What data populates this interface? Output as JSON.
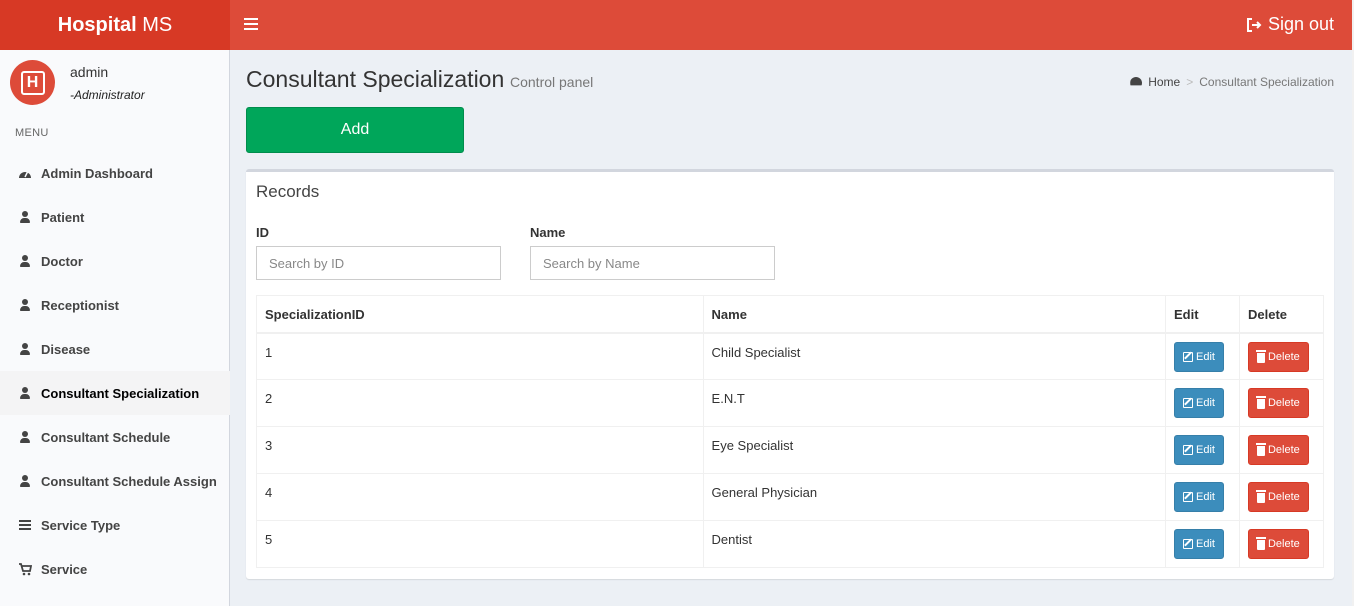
{
  "header": {
    "logo_bold": "Hospital",
    "logo_light": "MS",
    "signout_label": "Sign out"
  },
  "sidebar": {
    "user_name": "admin",
    "user_role": "-Administrator",
    "avatar_letter": "H",
    "menu_header": "MENU",
    "items": [
      {
        "label": "Admin Dashboard",
        "icon": "dashboard-icon"
      },
      {
        "label": "Patient",
        "icon": "user-icon"
      },
      {
        "label": "Doctor",
        "icon": "user-icon"
      },
      {
        "label": "Receptionist",
        "icon": "user-icon"
      },
      {
        "label": "Disease",
        "icon": "user-icon"
      },
      {
        "label": "Consultant Specialization",
        "icon": "user-icon",
        "active": true
      },
      {
        "label": "Consultant Schedule",
        "icon": "user-icon"
      },
      {
        "label": "Consultant Schedule Assign",
        "icon": "user-icon"
      },
      {
        "label": "Service Type",
        "icon": "list-icon"
      },
      {
        "label": "Service",
        "icon": "cart-icon"
      }
    ]
  },
  "content": {
    "title": "Consultant Specialization",
    "subtitle": "Control panel",
    "breadcrumb_home": "Home",
    "breadcrumb_sep": ">",
    "breadcrumb_current": "Consultant Specialization",
    "add_label": "Add"
  },
  "records": {
    "title": "Records",
    "id_label": "ID",
    "id_placeholder": "Search by ID",
    "name_label": "Name",
    "name_placeholder": "Search by Name",
    "columns": [
      "SpecializationID",
      "Name",
      "Edit",
      "Delete"
    ],
    "edit_label": "Edit",
    "delete_label": "Delete",
    "rows": [
      {
        "id": "1",
        "name": "Child Specialist"
      },
      {
        "id": "2",
        "name": "E.N.T"
      },
      {
        "id": "3",
        "name": "Eye Specialist"
      },
      {
        "id": "4",
        "name": "General Physician"
      },
      {
        "id": "5",
        "name": "Dentist"
      }
    ]
  },
  "colors": {
    "header_red": "#dd4b39",
    "logo_red": "#d73925",
    "add_green": "#00a65a",
    "edit_blue": "#3c8dbc",
    "delete_red": "#dd4b39"
  }
}
